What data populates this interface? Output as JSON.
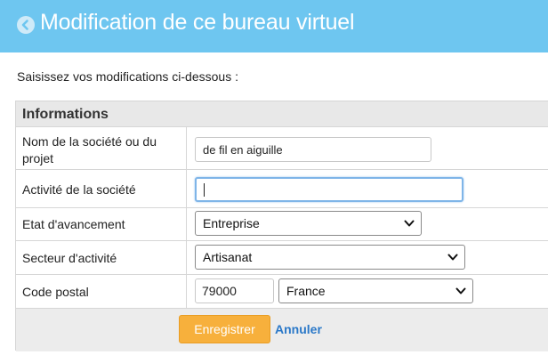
{
  "header": {
    "title": "Modification de ce bureau virtuel",
    "back_icon": "chevron-left-circle-icon",
    "color": "#6ec6f0"
  },
  "instructions": "Saisissez vos modifications ci-dessous :",
  "form": {
    "section_title": "Informations",
    "company_name": {
      "label_line1": "Nom de la société ou du",
      "label_line2": "projet",
      "value": "de fil en aiguille"
    },
    "activity": {
      "label": "Activité de la société",
      "value": ""
    },
    "status": {
      "label": "Etat d'avancement",
      "selected": "Entreprise"
    },
    "sector": {
      "label": "Secteur d'activité",
      "selected": "Artisanat"
    },
    "postal": {
      "label": "Code postal",
      "code": "79000",
      "country": "France"
    }
  },
  "actions": {
    "save_label": "Enregistrer",
    "cancel_label": "Annuler",
    "save_color": "#f7b03c",
    "link_color": "#2a78c8"
  }
}
